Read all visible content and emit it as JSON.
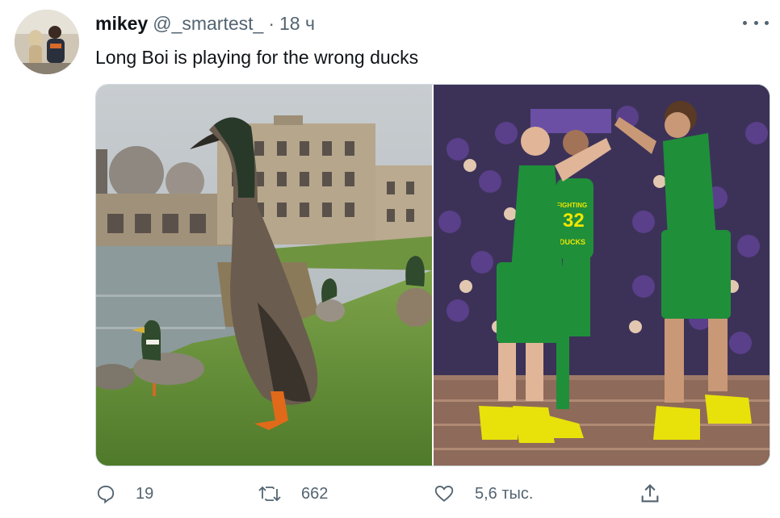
{
  "tweet": {
    "author_name": "mikey",
    "handle": "@_smartest_",
    "separator": "·",
    "time": "18 ч",
    "text": "Long Boi is playing for the wrong ducks",
    "media": [
      {
        "alt_icon": "duck-photo"
      },
      {
        "alt_icon": "basketball-photo",
        "jersey_number": "32",
        "jersey_text": "DUCKS",
        "jersey_top": "FIGHTING"
      }
    ],
    "actions": {
      "reply_count": "19",
      "retweet_count": "662",
      "like_count": "5,6 тыс."
    }
  },
  "icons": {
    "reply": "reply-icon",
    "retweet": "retweet-icon",
    "like": "heart-icon",
    "share": "share-icon",
    "more": "more-icon"
  },
  "colors": {
    "text": "#0f1419",
    "secondary": "#536471",
    "border": "#cfd9de",
    "oregon_green": "#1f8f3a",
    "oregon_yellow": "#f2e600"
  }
}
